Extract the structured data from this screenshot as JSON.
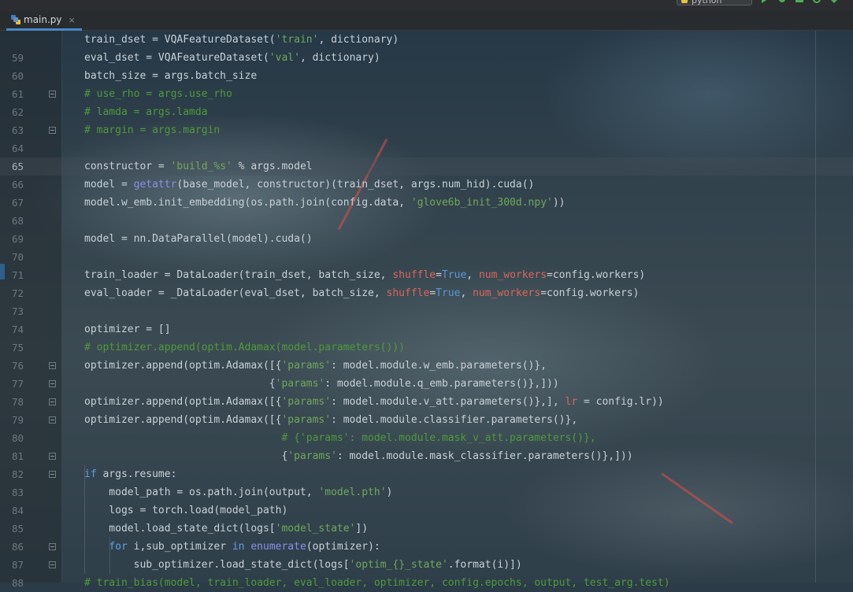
{
  "window": {
    "run_config_label": "python",
    "toolbar_icons": [
      "run-icon",
      "debug-icon",
      "coverage-icon",
      "profile-icon",
      "build-icon"
    ]
  },
  "tab": {
    "filename": "main.py",
    "close_glyph": "×"
  },
  "editor": {
    "current_line": 65,
    "lines": [
      {
        "n": "",
        "tokens": [
          [
            "",
            "train_dset = VQAFeatureDataset("
          ],
          [
            "s",
            "'train'"
          ],
          [
            "",
            ", dictionary)"
          ]
        ]
      },
      {
        "n": "59",
        "tokens": [
          [
            "",
            "eval_dset = VQAFeatureDataset("
          ],
          [
            "s",
            "'val'"
          ],
          [
            "",
            ", dictionary)"
          ]
        ]
      },
      {
        "n": "60",
        "tokens": [
          [
            "",
            "batch_size = args.batch_size"
          ]
        ]
      },
      {
        "n": "61",
        "tokens": [
          [
            "cm",
            "# use_rho = args.use_rho"
          ]
        ]
      },
      {
        "n": "62",
        "tokens": [
          [
            "cm",
            "# lamda = args.lamda"
          ]
        ]
      },
      {
        "n": "63",
        "tokens": [
          [
            "cm",
            "# margin = args.margin"
          ]
        ]
      },
      {
        "n": "64",
        "tokens": []
      },
      {
        "n": "65",
        "tokens": [
          [
            "",
            "constructor = "
          ],
          [
            "s",
            "'build_%s'"
          ],
          [
            "",
            " % args.model"
          ]
        ]
      },
      {
        "n": "66",
        "tokens": [
          [
            "",
            "model = "
          ],
          [
            "bi",
            "getattr"
          ],
          [
            "",
            "(base_model, constructor)(train_dset, args.num_hid).cuda()"
          ]
        ]
      },
      {
        "n": "67",
        "tokens": [
          [
            "",
            "model.w_emb.init_embedding(os.path.join(config.data, "
          ],
          [
            "s",
            "'glove6b_init_300d.npy'"
          ],
          [
            "",
            "))"
          ]
        ]
      },
      {
        "n": "68",
        "tokens": []
      },
      {
        "n": "69",
        "tokens": [
          [
            "",
            "model = nn.DataParallel(model).cuda()"
          ]
        ]
      },
      {
        "n": "70",
        "tokens": []
      },
      {
        "n": "71",
        "tokens": [
          [
            "",
            "train_loader = DataLoader(train_dset, batch_size, "
          ],
          [
            "p",
            "shuffle"
          ],
          [
            "",
            "="
          ],
          [
            "t",
            "True"
          ],
          [
            "",
            ", "
          ],
          [
            "p",
            "num_workers"
          ],
          [
            "",
            "=config.workers)"
          ]
        ]
      },
      {
        "n": "72",
        "tokens": [
          [
            "",
            "eval_loader = _DataLoader(eval_dset, batch_size, "
          ],
          [
            "p",
            "shuffle"
          ],
          [
            "",
            "="
          ],
          [
            "t",
            "True"
          ],
          [
            "",
            ", "
          ],
          [
            "p",
            "num_workers"
          ],
          [
            "",
            "=config.workers)"
          ]
        ]
      },
      {
        "n": "73",
        "tokens": []
      },
      {
        "n": "74",
        "tokens": [
          [
            "",
            "optimizer = []"
          ]
        ]
      },
      {
        "n": "75",
        "tokens": [
          [
            "cm",
            "# optimizer.append(optim.Adamax(model.parameters()))"
          ]
        ]
      },
      {
        "n": "76",
        "tokens": [
          [
            "",
            "optimizer.append(optim.Adamax([{"
          ],
          [
            "s",
            "'params'"
          ],
          [
            "",
            ": model.module.w_emb.parameters()},"
          ]
        ]
      },
      {
        "n": "77",
        "tokens": [
          [
            "",
            "                              {"
          ],
          [
            "s",
            "'params'"
          ],
          [
            "",
            ": model.module.q_emb.parameters()},]))"
          ]
        ]
      },
      {
        "n": "78",
        "tokens": [
          [
            "",
            "optimizer.append(optim.Adamax([{"
          ],
          [
            "s",
            "'params'"
          ],
          [
            "",
            ": model.module.v_att.parameters()},], "
          ],
          [
            "p",
            "lr"
          ],
          [
            "",
            " = config.lr))"
          ]
        ]
      },
      {
        "n": "79",
        "tokens": [
          [
            "",
            "optimizer.append(optim.Adamax([{"
          ],
          [
            "s",
            "'params'"
          ],
          [
            "",
            ": model.module.classifier.parameters()},"
          ]
        ]
      },
      {
        "n": "80",
        "tokens": [
          [
            "cm",
            "                                # {'params': model.module.mask_v_att.parameters()},"
          ]
        ]
      },
      {
        "n": "81",
        "tokens": [
          [
            "",
            "                                {"
          ],
          [
            "s",
            "'params'"
          ],
          [
            "",
            ": model.module.mask_classifier.parameters()},]))"
          ]
        ]
      },
      {
        "n": "82",
        "tokens": [
          [
            "k",
            "if"
          ],
          [
            "",
            " args.resume:"
          ]
        ]
      },
      {
        "n": "83",
        "tokens": [
          [
            "",
            "    model_path = os.path.join(output, "
          ],
          [
            "s",
            "'model.pth'"
          ],
          [
            "",
            ")"
          ]
        ]
      },
      {
        "n": "84",
        "tokens": [
          [
            "",
            "    logs = torch.load(model_path)"
          ]
        ]
      },
      {
        "n": "85",
        "tokens": [
          [
            "",
            "    model.load_state_dict(logs["
          ],
          [
            "s",
            "'model_state'"
          ],
          [
            "",
            "])"
          ]
        ]
      },
      {
        "n": "86",
        "tokens": [
          [
            "",
            "    "
          ],
          [
            "k",
            "for"
          ],
          [
            "",
            " i,sub_optimizer "
          ],
          [
            "k",
            "in"
          ],
          [
            "",
            " "
          ],
          [
            "bi",
            "enumerate"
          ],
          [
            "",
            "(optimizer):"
          ]
        ]
      },
      {
        "n": "87",
        "tokens": [
          [
            "",
            "        sub_optimizer.load_state_dict(logs["
          ],
          [
            "s",
            "'optim_{}_state'"
          ],
          [
            "",
            ".format(i)])"
          ]
        ]
      },
      {
        "n": "88",
        "tokens": [
          [
            "cm",
            "# train_bias(model, train_loader, eval_loader, optimizer, config.epochs, output, test_arg.test)"
          ]
        ]
      }
    ]
  }
}
